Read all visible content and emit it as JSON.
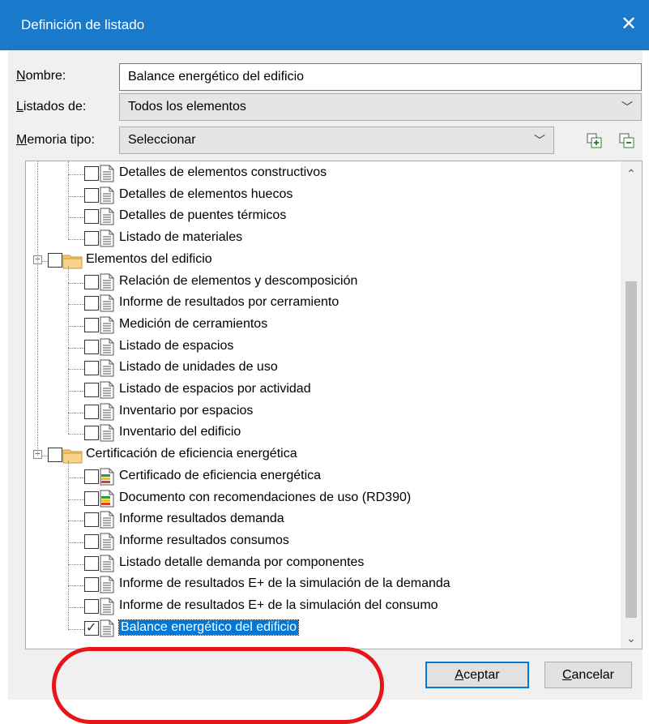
{
  "window": {
    "title": "Definición de listado",
    "close_glyph": "✕"
  },
  "form": {
    "nombre": {
      "label_u": "N",
      "label_rest": "ombre:",
      "value": "Balance energético del edificio"
    },
    "listados": {
      "label_u": "L",
      "label_rest": "istados de:",
      "value": "Todos los elementos"
    },
    "memoria": {
      "label_u": "M",
      "label_rest": "emoria tipo:",
      "value": "Seleccionar"
    },
    "chevron": "﹀",
    "icons": [
      "add-copy-icon",
      "remove-copy-icon"
    ]
  },
  "tree": {
    "items": [
      {
        "label": "Detalles de elementos constructivos",
        "checked": false,
        "type": "doc"
      },
      {
        "label": "Detalles de elementos huecos",
        "checked": false,
        "type": "doc"
      },
      {
        "label": "Detalles de puentes térmicos",
        "checked": false,
        "type": "doc"
      },
      {
        "label": "Listado de materiales",
        "checked": false,
        "type": "doc"
      },
      {
        "label": "Elementos del edificio",
        "checked": false,
        "type": "folder",
        "expanded": true
      },
      {
        "label": "Relación de elementos y descomposición",
        "checked": false,
        "type": "doc"
      },
      {
        "label": "Informe de resultados por cerramiento",
        "checked": false,
        "type": "doc"
      },
      {
        "label": "Medición de cerramientos",
        "checked": false,
        "type": "doc"
      },
      {
        "label": "Listado de espacios",
        "checked": false,
        "type": "doc"
      },
      {
        "label": "Listado de unidades de uso",
        "checked": false,
        "type": "doc"
      },
      {
        "label": "Listado de espacios por actividad",
        "checked": false,
        "type": "doc"
      },
      {
        "label": "Inventario por espacios",
        "checked": false,
        "type": "doc"
      },
      {
        "label": "Inventario del edificio",
        "checked": false,
        "type": "doc"
      },
      {
        "label": "Certificación de eficiencia energética",
        "checked": false,
        "type": "folder",
        "expanded": true
      },
      {
        "label": "Certificado de eficiencia energética",
        "checked": false,
        "type": "cert"
      },
      {
        "label": "Documento con recomendaciones de uso (RD390)",
        "checked": false,
        "type": "cert"
      },
      {
        "label": "Informe resultados demanda",
        "checked": false,
        "type": "doc"
      },
      {
        "label": "Informe resultados consumos",
        "checked": false,
        "type": "doc"
      },
      {
        "label": "Listado detalle demanda por componentes",
        "checked": false,
        "type": "doc"
      },
      {
        "label": "Informe de resultados E+ de la simulación de la demanda",
        "checked": false,
        "type": "doc"
      },
      {
        "label": "Informe de resultados E+ de la simulación del consumo",
        "checked": false,
        "type": "doc"
      },
      {
        "label": "Balance energético del edificio",
        "checked": true,
        "type": "doc",
        "selected": true
      }
    ],
    "scroll_up": "⌃",
    "scroll_down": "⌄"
  },
  "buttons": {
    "aceptar": {
      "u": "A",
      "rest": "ceptar"
    },
    "cancelar": {
      "u": "C",
      "rest": "ancelar"
    }
  },
  "colors": {
    "titlebar": "#1979ca",
    "selection": "#0078d7",
    "annotation": "#e8141c"
  }
}
